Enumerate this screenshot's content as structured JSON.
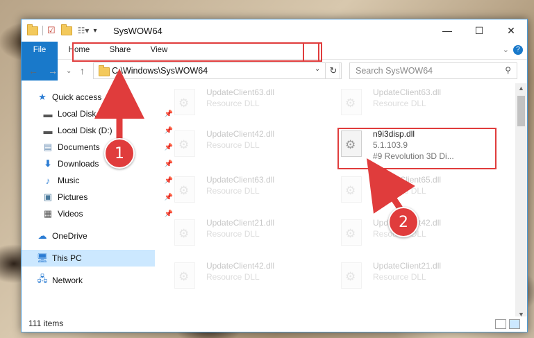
{
  "window": {
    "title": "SysWOW64"
  },
  "ribbon": {
    "tabs": [
      "File",
      "Home",
      "Share",
      "View"
    ]
  },
  "address": {
    "path": "C:\\Windows\\SysWOW64"
  },
  "search": {
    "placeholder": "Search SysWOW64"
  },
  "sidebar": {
    "items": [
      {
        "label": "Quick access",
        "icon": "star-icon"
      },
      {
        "label": "Local Disk (C:)",
        "icon": "drive-icon"
      },
      {
        "label": "Local Disk (D:)",
        "icon": "drive-icon"
      },
      {
        "label": "Documents",
        "icon": "document-icon"
      },
      {
        "label": "Downloads",
        "icon": "download-icon"
      },
      {
        "label": "Music",
        "icon": "music-icon"
      },
      {
        "label": "Pictures",
        "icon": "pictures-icon"
      },
      {
        "label": "Videos",
        "icon": "videos-icon"
      },
      {
        "label": "OneDrive",
        "icon": "cloud-icon"
      },
      {
        "label": "This PC",
        "icon": "computer-icon"
      },
      {
        "label": "Network",
        "icon": "network-icon"
      }
    ]
  },
  "files": [
    {
      "name": "UpdateClient63.dll",
      "sub": "Resource DLL"
    },
    {
      "name": "UpdateClient63.dll",
      "sub": "Resource DLL"
    },
    {
      "name": "UpdateClient42.dll",
      "sub": "Resource DLL"
    },
    {
      "name": "n9i3disp.dll",
      "sub": "5.1.103.9",
      "sub2": "#9 Revolution 3D Di..."
    },
    {
      "name": "UpdateClient63.dll",
      "sub": "Resource DLL"
    },
    {
      "name": "UpdateClient65.dll",
      "sub": "Resource DLL"
    },
    {
      "name": "UpdateClient21.dll",
      "sub": "Resource DLL"
    },
    {
      "name": "UpdateClient42.dll",
      "sub": "Resource DLL"
    },
    {
      "name": "UpdateClient42.dll",
      "sub": "Resource DLL"
    },
    {
      "name": "UpdateClient21.dll",
      "sub": "Resource DLL"
    }
  ],
  "status": {
    "item_count": "111 items"
  },
  "annotations": {
    "step1": "1",
    "step2": "2"
  },
  "colors": {
    "accent": "#1979ca",
    "highlight": "#e03c3c",
    "selection": "#cce8ff"
  }
}
